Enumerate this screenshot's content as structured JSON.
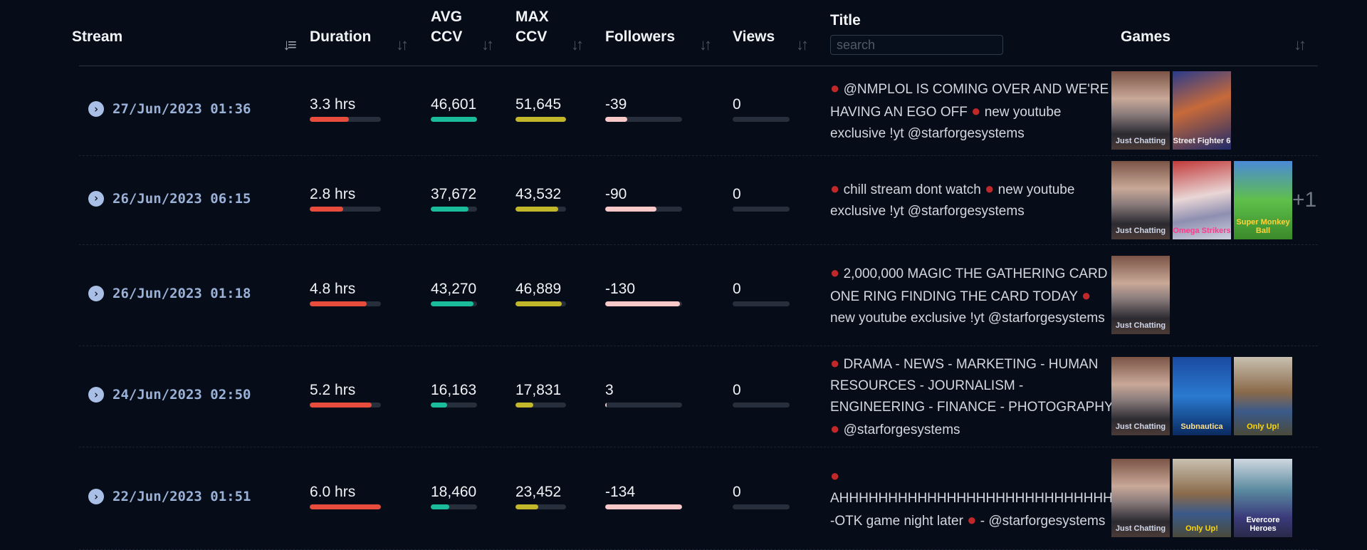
{
  "header": {
    "stream": "Stream",
    "duration": "Duration",
    "avg_ccv": [
      "AVG",
      "CCV"
    ],
    "max_ccv": [
      "MAX",
      "CCV"
    ],
    "followers": "Followers",
    "views": "Views",
    "title": "Title",
    "title_search_placeholder": "search",
    "games": "Games",
    "sort_icon": "sort-arrows-icon",
    "active_sort": "stream-descending"
  },
  "colors": {
    "background": "#060d19",
    "duration_bar": "#e74c3c",
    "avg_bar": "#1abc9c",
    "max_bar": "#c2b62a",
    "followers_bar": "#f9c9c9",
    "bar_track": "#262f3b",
    "live_dot": "#c0282a",
    "date_text": "#9bb2d8"
  },
  "rows": [
    {
      "date": "27/Jun/2023 01:36",
      "duration": "3.3 hrs",
      "duration_frac": 0.55,
      "avg": "46,601",
      "avg_frac": 1.0,
      "max": "51,645",
      "max_frac": 1.0,
      "followers": "-39",
      "followers_frac": 0.29,
      "views": "0",
      "views_frac": 0,
      "title": "● @NMPLOL IS COMING OVER AND WE'RE HAVING AN EGO OFF ● new youtube exclusive !yt @starforgesystems",
      "games": [
        "Just Chatting",
        "Street Fighter 6"
      ],
      "more": ""
    },
    {
      "date": "26/Jun/2023 06:15",
      "duration": "2.8 hrs",
      "duration_frac": 0.47,
      "avg": "37,672",
      "avg_frac": 0.81,
      "max": "43,532",
      "max_frac": 0.84,
      "followers": "-90",
      "followers_frac": 0.67,
      "views": "0",
      "views_frac": 0,
      "title": "● chill stream dont watch ● new youtube exclusive !yt @starforgesystems",
      "games": [
        "Just Chatting",
        "Omega Strikers",
        "Super Monkey Ball"
      ],
      "more": "+1"
    },
    {
      "date": "26/Jun/2023 01:18",
      "duration": "4.8 hrs",
      "duration_frac": 0.8,
      "avg": "43,270",
      "avg_frac": 0.93,
      "max": "46,889",
      "max_frac": 0.91,
      "followers": "-130",
      "followers_frac": 0.97,
      "views": "0",
      "views_frac": 0,
      "title": "● 2,000,000 MAGIC THE GATHERING CARD ONE RING FINDING THE CARD TODAY ● new youtube exclusive !yt @starforgesystems",
      "games": [
        "Just Chatting"
      ],
      "more": ""
    },
    {
      "date": "24/Jun/2023 02:50",
      "duration": "5.2 hrs",
      "duration_frac": 0.87,
      "avg": "16,163",
      "avg_frac": 0.35,
      "max": "17,831",
      "max_frac": 0.35,
      "followers": "3",
      "followers_frac": 0.02,
      "views": "0",
      "views_frac": 0,
      "title": "● DRAMA - NEWS - MARKETING - HUMAN RESOURCES - JOURNALISM - ENGINEERING - FINANCE - PHOTOGRAPHY ● @starforgesystems",
      "games": [
        "Just Chatting",
        "Subnautica",
        "Only Up!"
      ],
      "more": ""
    },
    {
      "date": "22/Jun/2023 01:51",
      "duration": "6.0 hrs",
      "duration_frac": 1.0,
      "avg": "18,460",
      "avg_frac": 0.4,
      "max": "23,452",
      "max_frac": 0.45,
      "followers": "-134",
      "followers_frac": 1.0,
      "views": "0",
      "views_frac": 0,
      "title": "● AHHHHHHHHHHHHHHHHHHHHHHHHHHHHH -OTK game night later ● - @starforgesystems",
      "games": [
        "Just Chatting",
        "Only Up!",
        "Evercore Heroes"
      ],
      "more": ""
    }
  ]
}
